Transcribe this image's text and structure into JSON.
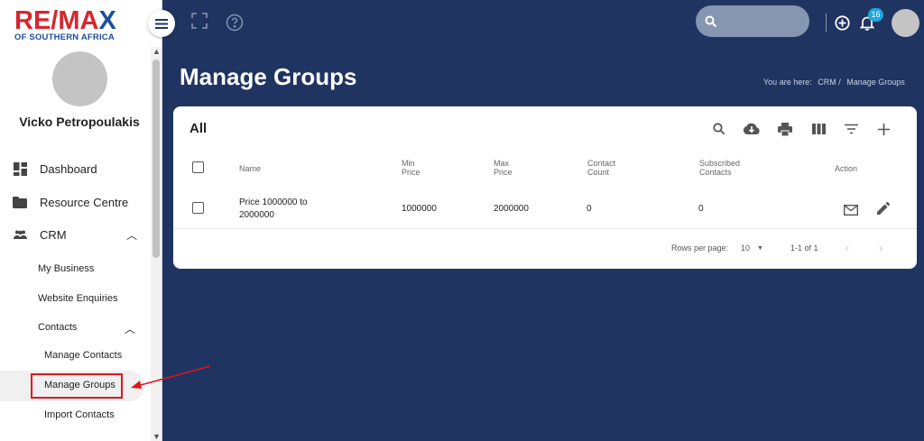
{
  "brand": {
    "logo_main_a": "RE/MA",
    "logo_main_b": "X",
    "logo_sub": "OF SOUTHERN AFRICA"
  },
  "user": {
    "name": "Vicko Petropoulakis"
  },
  "sidebar": {
    "items": [
      {
        "label": "Dashboard",
        "icon": "dashboard-icon"
      },
      {
        "label": "Resource Centre",
        "icon": "folder-icon"
      },
      {
        "label": "CRM",
        "icon": "people-icon"
      }
    ],
    "crm_items": [
      "My Business",
      "Website Enquiries",
      "Contacts"
    ],
    "contacts_items": [
      "Manage Contacts",
      "Manage Groups",
      "Import Contacts"
    ]
  },
  "header": {
    "notifications_count": "16"
  },
  "page": {
    "title": "Manage Groups",
    "breadcrumb_prefix": "You are here:",
    "breadcrumb_crm": "CRM /",
    "breadcrumb_current": "Manage Groups"
  },
  "table": {
    "title": "All",
    "headers": {
      "name": "Name",
      "min_price_1": "Min",
      "min_price_2": "Price",
      "max_price_1": "Max",
      "max_price_2": "Price",
      "contact_count_1": "Contact",
      "contact_count_2": "Count",
      "subscribed_1": "Subscribed",
      "subscribed_2": "Contacts",
      "action": "Action"
    },
    "rows": [
      {
        "name_1": "Price 1000000 to",
        "name_2": "2000000",
        "min_price": "1000000",
        "max_price": "2000000",
        "contact_count": "0",
        "subscribed": "0"
      }
    ],
    "footer": {
      "rows_per_page_label": "Rows per page:",
      "rows_per_page_value": "10",
      "range": "1-1 of 1"
    }
  },
  "colors": {
    "background": "#1f3461",
    "brand_red": "#d7262e",
    "brand_blue": "#1b4e9c",
    "badge": "#1ea7e0",
    "highlight": "#e0141e"
  }
}
